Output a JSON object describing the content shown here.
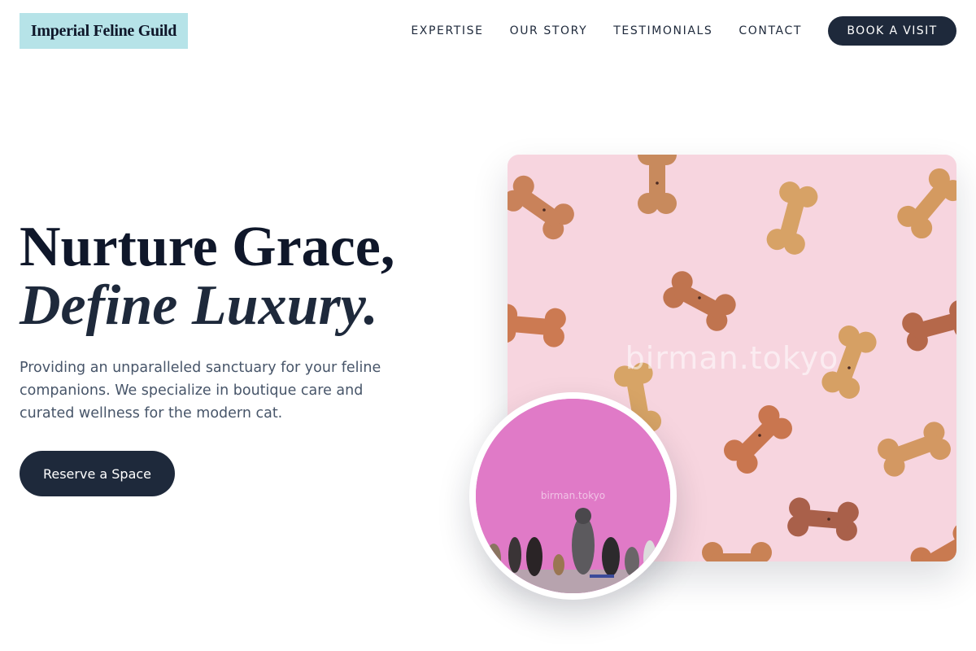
{
  "brand": {
    "name": "Imperial Feline Guild"
  },
  "nav": {
    "links": [
      "EXPERTISE",
      "OUR STORY",
      "TESTIMONIALS",
      "CONTACT"
    ],
    "cta_label": "BOOK A VISIT"
  },
  "hero": {
    "title_line1": "Nurture Grace,",
    "title_line2": "Define Luxury.",
    "description": "Providing an unparalleled sanctuary for your feline companions. We specialize in boutique care and curated wellness for the modern cat.",
    "button_label": "Reserve a Space"
  },
  "images": {
    "main_watermark": "birman.tokyo",
    "circle_watermark": "birman.tokyo"
  },
  "colors": {
    "logo_bg": "#b6e3e8",
    "primary_dark": "#1e293b",
    "main_photo_bg": "#f7d5df",
    "circle_photo_bg": "#e07ac7"
  }
}
